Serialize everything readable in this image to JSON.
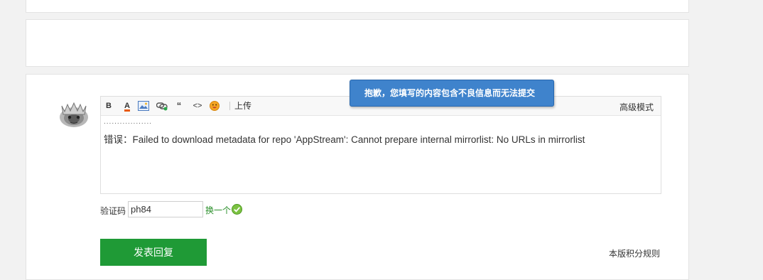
{
  "toolbar": {
    "bold": "B",
    "font_color": "A",
    "upload": "上传",
    "advanced_mode": "高级模式",
    "icons": [
      "bold-icon",
      "font-color-icon",
      "image-icon",
      "link-icon",
      "quote-icon",
      "code-icon",
      "emoji-icon"
    ]
  },
  "editor": {
    "dots": "..................",
    "content": "错误：Failed to download metadata for repo 'AppStream': Cannot prepare internal mirrorlist: No URLs in mirrorlist"
  },
  "tooltip": {
    "message": "抱歉，您填写的内容包含不良信息而无法提交"
  },
  "captcha": {
    "label": "验证码",
    "value": "ph84",
    "change_label": "换一个"
  },
  "actions": {
    "submit": "发表回复",
    "rules": "本版积分规则"
  },
  "colors": {
    "accent_green": "#1f9a36",
    "tooltip_blue": "#3f83cc",
    "link_green": "#2a8f2a"
  }
}
